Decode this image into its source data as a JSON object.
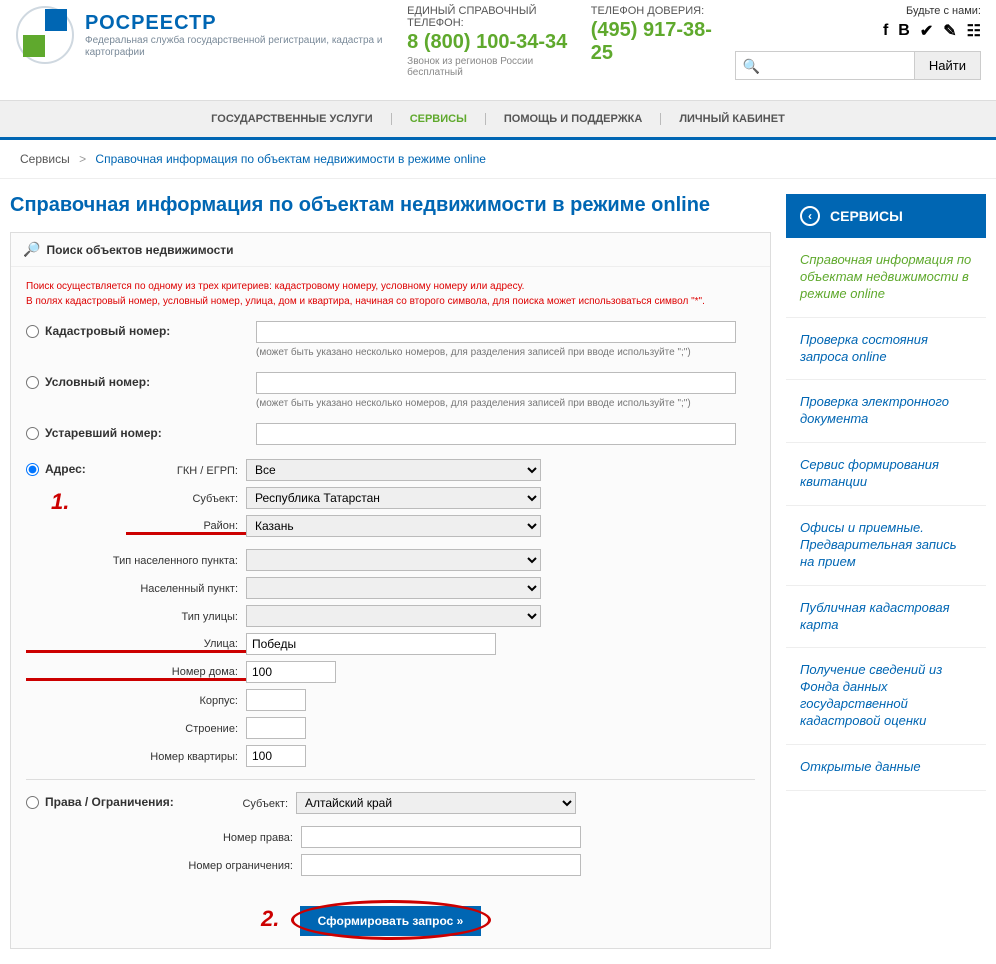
{
  "header": {
    "logo_title": "РОСРЕЕСТР",
    "logo_sub": "Федеральная служба государственной регистрации, кадастра и картографии",
    "phone1_label": "ЕДИНЫЙ СПРАВОЧНЫЙ ТЕЛЕФОН:",
    "phone1_number": "8 (800) 100-34-34",
    "phone1_note": "Звонок из регионов России бесплатный",
    "phone2_label": "ТЕЛЕФОН ДОВЕРИЯ:",
    "phone2_number": "(495) 917-38-25",
    "social_label": "Будьте с нами:",
    "search_button": "Найти"
  },
  "nav": {
    "items": [
      "ГОСУДАРСТВЕННЫЕ УСЛУГИ",
      "СЕРВИСЫ",
      "ПОМОЩЬ И ПОДДЕРЖКА",
      "ЛИЧНЫЙ КАБИНЕТ"
    ]
  },
  "breadcrumb": {
    "root": "Сервисы",
    "sep": ">",
    "current": "Справочная информация по объектам недвижимости в режиме online"
  },
  "page": {
    "title": "Справочная информация по объектам недвижимости в режиме online",
    "panel_header": "Поиск объектов недвижимости",
    "hint1": "Поиск осуществляется по одному из трех критериев: кадастровому номеру, условному номеру или адресу.",
    "hint2": "В полях кадастровый номер, условный номер, улица, дом и квартира, начиная со второго символа, для поиска может использоваться символ \"*\".",
    "labels": {
      "cadastral": "Кадастровый номер:",
      "cadastral_note": "(может быть указано несколько номеров, для разделения записей при вводе используйте \";\")",
      "conditional": "Условный номер:",
      "conditional_note": "(может быть указано несколько номеров, для разделения записей при вводе используйте \";\")",
      "obsolete": "Устаревший номер:",
      "address": "Адрес:",
      "gkn": "ГКН / ЕГРП:",
      "subject": "Субъект:",
      "district": "Район:",
      "settlement_type": "Тип населенного пункта:",
      "settlement": "Населенный пункт:",
      "street_type": "Тип улицы:",
      "street": "Улица:",
      "house": "Номер дома:",
      "building": "Корпус:",
      "structure": "Строение:",
      "apartment": "Номер квартиры:",
      "rights": "Права / Ограничения:",
      "r_subject": "Субъект:",
      "r_right_num": "Номер права:",
      "r_restriction_num": "Номер ограничения:"
    },
    "values": {
      "gkn": "Все",
      "subject": "Республика Татарстан",
      "district": "Казань",
      "street": "Победы",
      "house": "100",
      "apartment": "100",
      "r_subject": "Алтайский край"
    },
    "submit": "Сформировать запрос »",
    "ann1": "1.",
    "ann2": "2."
  },
  "sidebar": {
    "header": "СЕРВИСЫ",
    "items": [
      "Справочная информация по объектам недвижимости в режиме online",
      "Проверка состояния запроса online",
      "Проверка электронного документа",
      "Сервис формирования квитанции",
      "Офисы и приемные. Предварительная запись на прием",
      "Публичная кадастровая карта",
      "Получение сведений из Фонда данных государственной кадастровой оценки",
      "Открытые данные"
    ]
  }
}
